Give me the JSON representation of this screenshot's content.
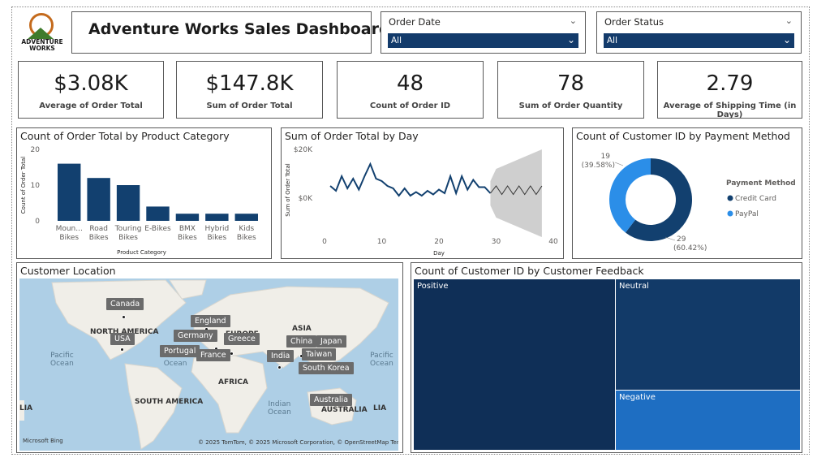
{
  "header": {
    "logo_text": "ADVENTURE\nWORKS",
    "title": "Adventure Works Sales Dashboard"
  },
  "slicers": [
    {
      "label": "Order Date",
      "value": "All"
    },
    {
      "label": "Order Status",
      "value": "All"
    }
  ],
  "kpis": [
    {
      "value": "$3.08K",
      "label": "Average of Order Total"
    },
    {
      "value": "$147.8K",
      "label": "Sum of Order Total"
    },
    {
      "value": "48",
      "label": "Count of Order ID"
    },
    {
      "value": "78",
      "label": "Sum of Order Quantity"
    },
    {
      "value": "2.79",
      "label": "Average of Shipping Time (in Days)"
    }
  ],
  "colors": {
    "dark_navy": "#133b6b",
    "bar": "#12406f",
    "light_blue": "#2b8ee8",
    "treemap_positive": "#0f2f57",
    "treemap_neutral": "#123a68",
    "treemap_negative": "#1e6ec2"
  },
  "chart_data": [
    {
      "type": "bar",
      "title": "Count of Order Total by Product Category",
      "xlabel": "Product Category",
      "ylabel": "Count of Order Total",
      "categories": [
        "Mountain Bikes",
        "Road Bikes",
        "Touring Bikes",
        "E-Bikes",
        "BMX Bikes",
        "Hybrid Bikes",
        "Kids Bikes"
      ],
      "tick_labels": [
        [
          "Moun...",
          "Bikes"
        ],
        [
          "Road",
          "Bikes"
        ],
        [
          "Touring",
          "Bikes"
        ],
        [
          "E-Bikes"
        ],
        [
          "BMX",
          "Bikes"
        ],
        [
          "Hybrid",
          "Bikes"
        ],
        [
          "Kids",
          "Bikes"
        ]
      ],
      "values": [
        16,
        12,
        10,
        4,
        2,
        2,
        2
      ],
      "yticks": [
        "0",
        "10",
        "20"
      ],
      "ylim": [
        0,
        20
      ]
    },
    {
      "type": "line",
      "title": "Sum of Order Total by Day",
      "xlabel": "Day",
      "ylabel": "Sum of Order Total",
      "x": [
        1,
        2,
        3,
        4,
        5,
        6,
        7,
        8,
        9,
        10,
        11,
        12,
        13,
        14,
        15,
        16,
        17,
        18,
        19,
        20,
        21,
        22,
        23,
        24,
        25,
        26,
        27,
        28,
        29
      ],
      "y": [
        5000,
        3000,
        9000,
        4000,
        8000,
        3500,
        9000,
        14000,
        8000,
        7000,
        5000,
        4000,
        1000,
        4000,
        1000,
        2500,
        1000,
        3000,
        1500,
        3500,
        2000,
        9000,
        2000,
        9000,
        3500,
        7500,
        4500,
        4500,
        2000
      ],
      "forecast_x": [
        29,
        30,
        31,
        32,
        33,
        34,
        35,
        36,
        37,
        38
      ],
      "forecast_y": [
        2000,
        5000,
        1500,
        5000,
        1500,
        5000,
        1500,
        5000,
        1500,
        5000
      ],
      "forecast_band": [
        [
          -3000,
          7000
        ],
        [
          -8000,
          12000
        ],
        [
          -9000,
          13000
        ],
        [
          -10000,
          14000
        ],
        [
          -11000,
          15000
        ],
        [
          -12000,
          16000
        ],
        [
          -13000,
          17000
        ],
        [
          -14000,
          18000
        ],
        [
          -15000,
          19000
        ],
        [
          -16000,
          20000
        ]
      ],
      "yticks": [
        "$20K",
        "$0K"
      ],
      "xticks": [
        "0",
        "10",
        "20",
        "30",
        "40"
      ],
      "xlim": [
        0,
        40
      ],
      "ylim": [
        -16000,
        20000
      ]
    },
    {
      "type": "pie",
      "title": "Count of Customer ID by Payment Method",
      "legend_title": "Payment Method",
      "labels": [
        "Credit Card",
        "PayPal"
      ],
      "values": [
        29,
        19
      ],
      "value_labels": [
        "29",
        "19"
      ],
      "percent_labels": [
        "(60.42%)",
        "(39.58%)"
      ]
    }
  ],
  "map": {
    "title": "Customer Location",
    "regions": [
      "NORTH AMERICA",
      "EUROPE",
      "ASIA",
      "AFRICA",
      "SOUTH AMERICA",
      "AUSTRALIA",
      "LIA",
      "LIA"
    ],
    "oceans": [
      "Pacific\nOcean",
      "Atlantic\nOcean",
      "Indian\nOcean",
      "Pacific\nOcean"
    ],
    "cities": [
      "Canada",
      "USA",
      "England",
      "Germany",
      "Portugal",
      "France",
      "Greece",
      "China",
      "Japan",
      "India",
      "Taiwan",
      "South Korea",
      "Australia"
    ],
    "bing": "Microsoft Bing",
    "copyright": "© 2025 TomTom, © 2025 Microsoft Corporation, © OpenStreetMap  Terms"
  },
  "treemap": {
    "title": "Count of Customer ID by Customer Feedback",
    "tiles": [
      {
        "label": "Positive"
      },
      {
        "label": "Neutral"
      },
      {
        "label": "Negative"
      }
    ]
  }
}
